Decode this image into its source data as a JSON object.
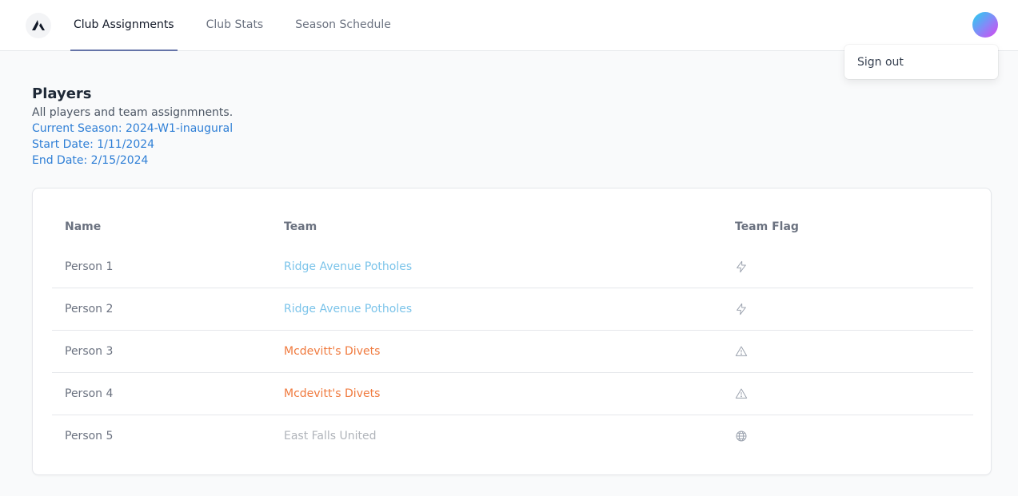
{
  "nav": {
    "tabs": [
      {
        "label": "Club Assignments",
        "active": true
      },
      {
        "label": "Club Stats",
        "active": false
      },
      {
        "label": "Season Schedule",
        "active": false
      }
    ]
  },
  "user_menu": {
    "sign_out": "Sign out"
  },
  "header": {
    "title": "Players",
    "subtitle": "All players and team assignmnents.",
    "current_season": "Current Season: 2024-W1-inaugural",
    "start_date": "Start Date: 1/11/2024",
    "end_date": "End Date: 2/15/2024"
  },
  "table": {
    "columns": [
      "Name",
      "Team",
      "Team Flag"
    ],
    "rows": [
      {
        "name": "Person 1",
        "team": "Ridge Avenue Potholes",
        "team_color": "#7cc4ea",
        "flag_icon": "bolt-icon"
      },
      {
        "name": "Person 2",
        "team": "Ridge Avenue Potholes",
        "team_color": "#7cc4ea",
        "flag_icon": "bolt-icon"
      },
      {
        "name": "Person 3",
        "team": "Mcdevitt's Divets",
        "team_color": "#f07a3e",
        "flag_icon": "warning-triangle-icon"
      },
      {
        "name": "Person 4",
        "team": "Mcdevitt's Divets",
        "team_color": "#f07a3e",
        "flag_icon": "warning-triangle-icon"
      },
      {
        "name": "Person 5",
        "team": "East Falls United",
        "team_color": "#b0b4ba",
        "flag_icon": "globe-icon"
      }
    ]
  },
  "colors": {
    "accent": "#2f7fd6",
    "active_tab_underline": "#6574a8"
  }
}
